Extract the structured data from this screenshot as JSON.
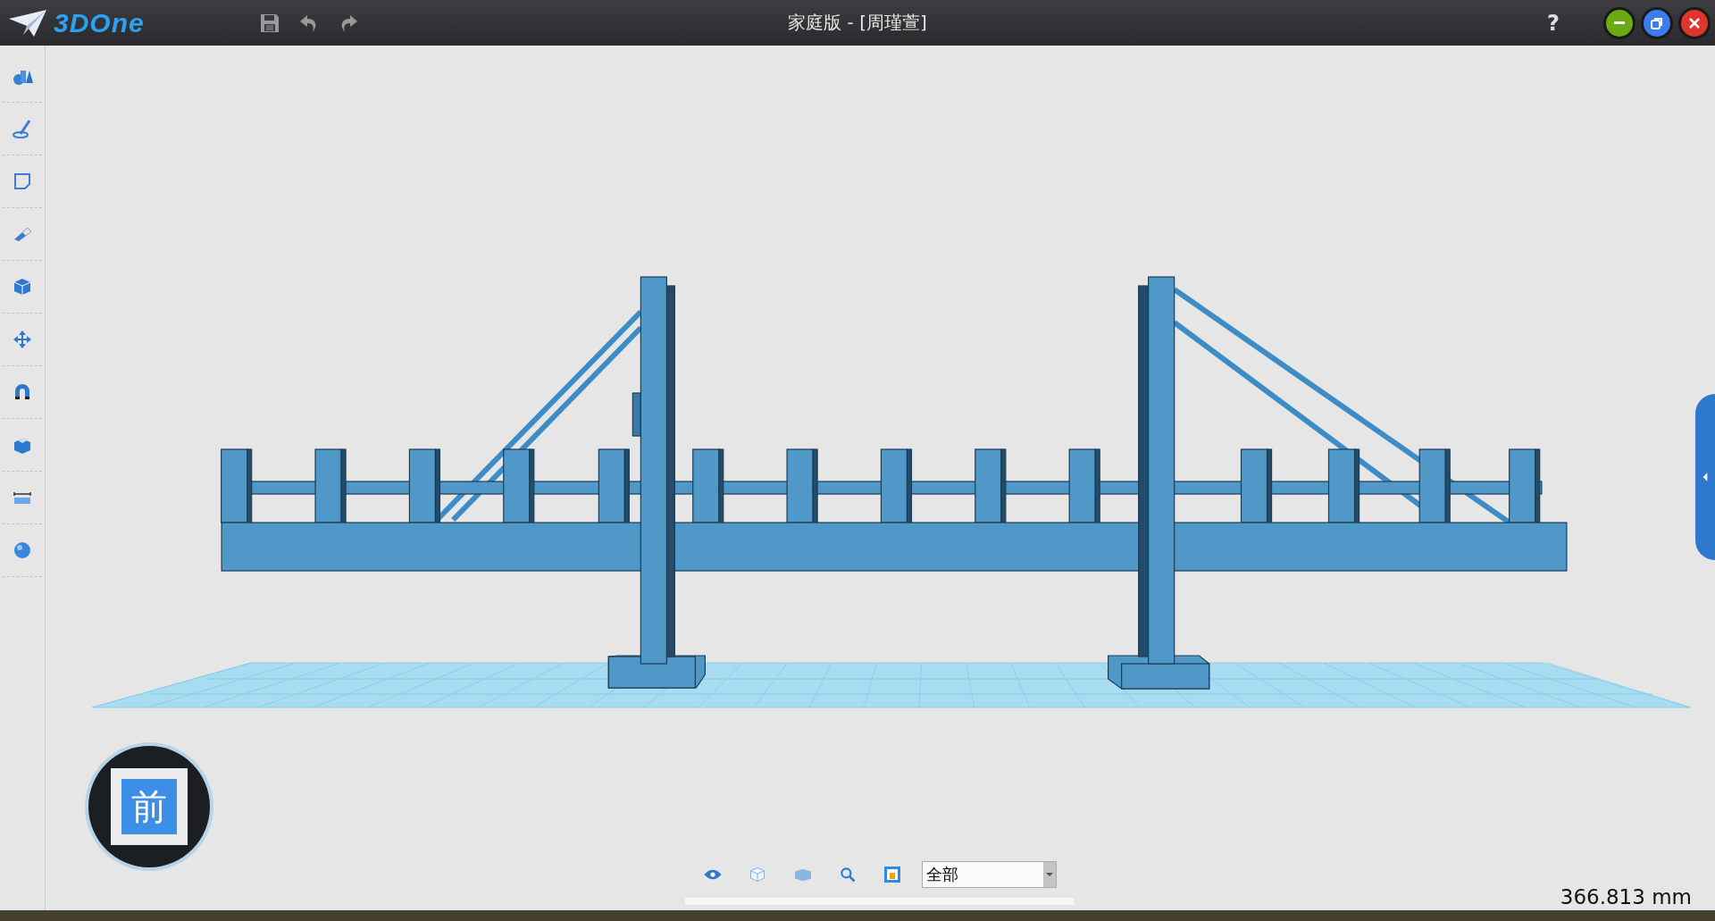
{
  "window": {
    "logo": "3DOne",
    "title": "家庭版 - [周瑾萱]",
    "help": "?"
  },
  "view_cube": {
    "face": "前"
  },
  "view_toolbar": {
    "filter": {
      "value": "全部"
    }
  },
  "measurement": "366.813 mm"
}
